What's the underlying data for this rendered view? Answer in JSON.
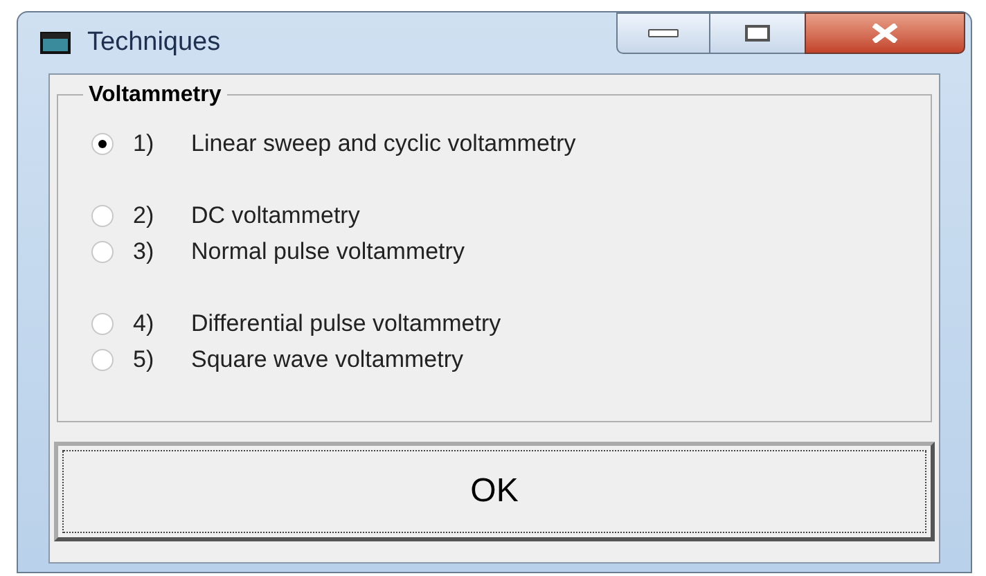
{
  "window": {
    "title": "Techniques"
  },
  "group": {
    "label": "Voltammetry",
    "option_groups": [
      [
        {
          "number": "1)",
          "label": "Linear sweep and cyclic voltammetry",
          "selected": true
        }
      ],
      [
        {
          "number": "2)",
          "label": "DC voltammetry",
          "selected": false
        },
        {
          "number": "3)",
          "label": "Normal pulse voltammetry",
          "selected": false
        }
      ],
      [
        {
          "number": "4)",
          "label": "Differential pulse voltammetry",
          "selected": false
        },
        {
          "number": "5)",
          "label": "Square wave voltammetry",
          "selected": false
        }
      ]
    ]
  },
  "ok_button": "OK"
}
